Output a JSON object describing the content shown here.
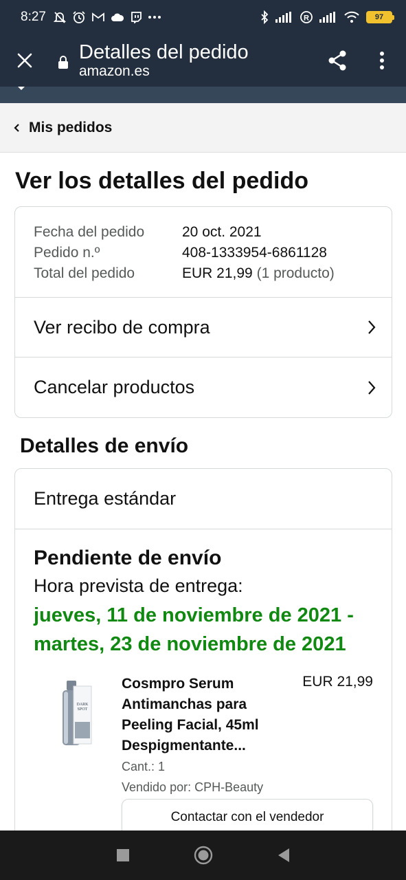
{
  "status_bar": {
    "time": "8:27",
    "icons_left": [
      "alarm-off-icon",
      "alarm-icon",
      "gmail-icon",
      "cloud-icon",
      "twitch-icon",
      "more-dots-icon"
    ],
    "icons_right": [
      "bluetooth-icon",
      "signal-icon",
      "registered-icon",
      "signal-icon",
      "wifi-icon",
      "battery-icon"
    ],
    "battery": "97"
  },
  "app_bar": {
    "title": "Detalles del pedido",
    "url": "amazon.es"
  },
  "breadcrumb": {
    "label": "Mis pedidos"
  },
  "page": {
    "title": "Ver los detalles del pedido"
  },
  "summary": {
    "rows": [
      {
        "label": "Fecha del pedido",
        "value": "20 oct. 2021"
      },
      {
        "label": "Pedido n.º",
        "value": "408-1333954-6861128"
      },
      {
        "label": "Total del pedido",
        "value": "EUR 21,99",
        "extra": "(1 producto)"
      }
    ],
    "links": [
      "Ver recibo de compra",
      "Cancelar productos"
    ]
  },
  "shipping": {
    "section_title": "Detalles de envío",
    "method": "Entrega estándar",
    "status": "Pendiente de envío",
    "eta_label": "Hora prevista de entrega:",
    "eta_line1": "jueves, 11 de noviembre de 2021 -",
    "eta_line2": "martes, 23 de noviembre de 2021",
    "eta_color": "#118811"
  },
  "product": {
    "name_lines": [
      "Cosmpro Serum",
      "Antimanchas para",
      "Peeling Facial, 45ml",
      "Despigmentante..."
    ],
    "price": "EUR 21,99",
    "quantity": "Cant.: 1",
    "seller": "Vendido por: CPH-Beauty",
    "contact_button": "Contactar con el vendedor",
    "image_text": [
      "DARK",
      "SPOT"
    ]
  },
  "nav_bar": {
    "buttons": [
      "recents-button",
      "home-button",
      "back-button"
    ]
  },
  "colors": {
    "header_bg": "#232f3e",
    "strip_bg": "#37475a",
    "breadcrumb_bg": "#f3f3f3",
    "border": "#d5d9d9",
    "secondary_text": "#565959"
  }
}
